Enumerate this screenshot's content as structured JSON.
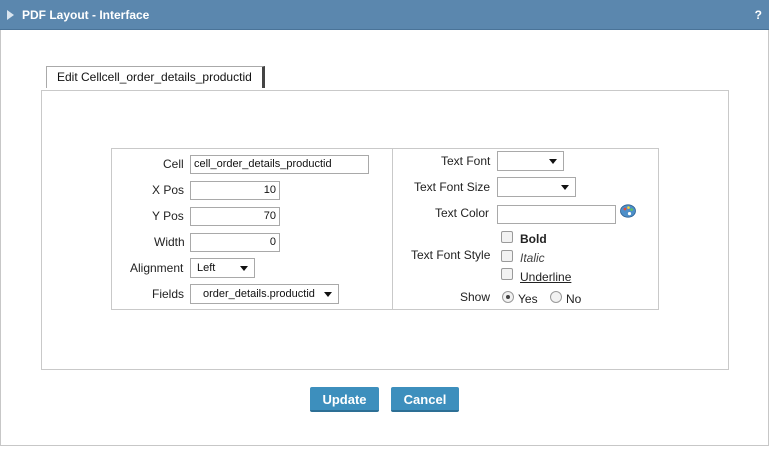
{
  "window": {
    "title": "PDF Layout - Interface",
    "help_label": "?"
  },
  "tab": {
    "label": "Edit Cellcell_order_details_productid"
  },
  "left_form": {
    "cell_label": "Cell",
    "cell_value": "cell_order_details_productid",
    "xpos_label": "X Pos",
    "xpos_value": "10",
    "ypos_label": "Y Pos",
    "ypos_value": "70",
    "width_label": "Width",
    "width_value": "0",
    "alignment_label": "Alignment",
    "alignment_value": "Left",
    "fields_label": "Fields",
    "fields_value": "order_details.productid"
  },
  "right_form": {
    "text_font_label": "Text Font",
    "text_font_value": "",
    "text_font_size_label": "Text Font Size",
    "text_font_size_value": "",
    "text_color_label": "Text Color",
    "text_color_value": "",
    "text_font_style_label": "Text Font Style",
    "style_options": {
      "bold": "Bold",
      "italic": "Italic",
      "underline": "Underline"
    },
    "show_label": "Show",
    "show_yes": "Yes",
    "show_no": "No",
    "show_selected": "Yes"
  },
  "buttons": {
    "update": "Update",
    "cancel": "Cancel"
  },
  "colors": {
    "titlebar": "#5b87ae",
    "button": "#3d8fbd"
  },
  "icons": {
    "collapse": "triangle-right-icon",
    "color_picker": "color-palette-icon"
  }
}
